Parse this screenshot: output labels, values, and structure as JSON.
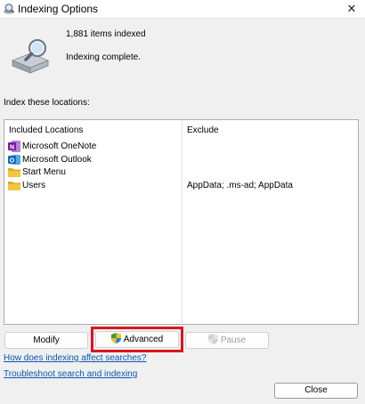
{
  "window": {
    "title": "Indexing Options",
    "icons": {
      "app": "magnifier-icon",
      "close": "close-icon"
    },
    "close_glyph": "✕"
  },
  "status": {
    "icon": "indexing-drive-icon",
    "items_indexed": "1,881 items indexed",
    "state": "Indexing complete."
  },
  "locations": {
    "section_label": "Index these locations:",
    "columns": {
      "included": "Included Locations",
      "exclude": "Exclude"
    },
    "rows": [
      {
        "label": "Microsoft OneNote",
        "icon": "onenote-icon",
        "exclude": ""
      },
      {
        "label": "Microsoft Outlook",
        "icon": "outlook-icon",
        "exclude": ""
      },
      {
        "label": "Start Menu",
        "icon": "folder-icon",
        "exclude": ""
      },
      {
        "label": "Users",
        "icon": "folder-icon",
        "exclude": "AppData; .ms-ad; AppData"
      }
    ]
  },
  "buttons": {
    "modify": "Modify",
    "advanced": "Advanced",
    "pause": "Pause",
    "close": "Close"
  },
  "links": {
    "affect_searches": "How does indexing affect searches?",
    "troubleshoot": "Troubleshoot search and indexing"
  },
  "colors": {
    "highlight": "#d8161f",
    "link": "#0a56b4",
    "onenote": "#7719aa",
    "outlook": "#0f6cbd",
    "folder": "#f4c542"
  }
}
